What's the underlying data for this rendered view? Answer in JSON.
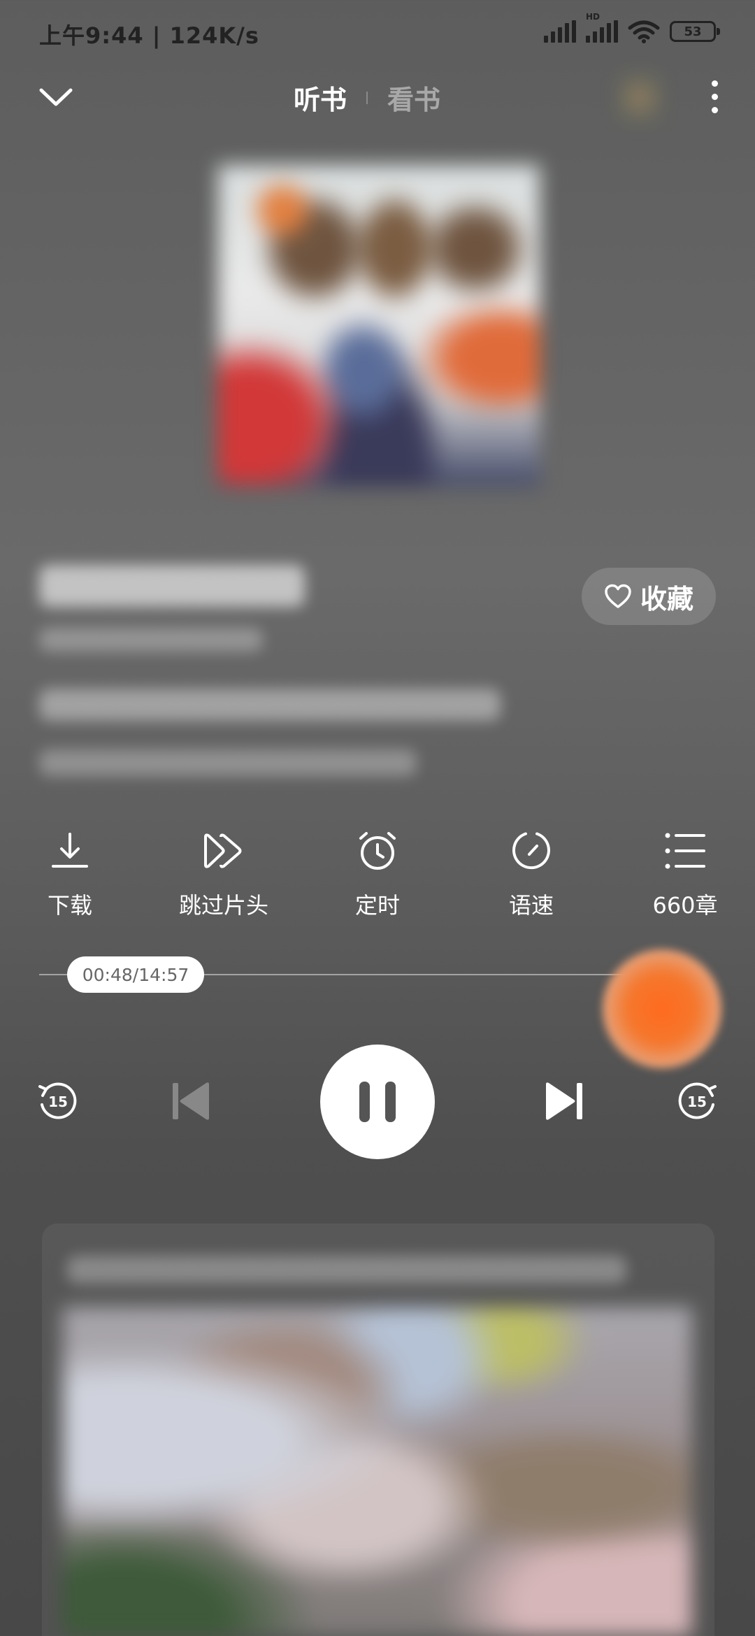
{
  "status_bar": {
    "time_speed": "上午9:44 | 124K/s",
    "network_label": "HD",
    "battery": "53"
  },
  "nav": {
    "tab_listen": "听书",
    "tab_read": "看书"
  },
  "favorite": {
    "label": "收藏"
  },
  "actions": {
    "download": "下载",
    "skip_intro": "跳过片头",
    "timer": "定时",
    "speed": "语速",
    "chapters": "660章"
  },
  "progress": {
    "time": "00:48/14:57",
    "fraction": 0.054
  },
  "controls": {
    "rewind_seconds": "15",
    "forward_seconds": "15"
  },
  "icons": [
    "chevron-down-icon",
    "more-vert-icon",
    "heart-icon",
    "download-icon",
    "skip-intro-icon",
    "alarm-icon",
    "speed-icon",
    "list-icon",
    "rewind-15-icon",
    "skip-previous-icon",
    "pause-icon",
    "skip-next-icon",
    "forward-15-icon",
    "wifi-icon",
    "signal-icon",
    "battery-icon"
  ]
}
